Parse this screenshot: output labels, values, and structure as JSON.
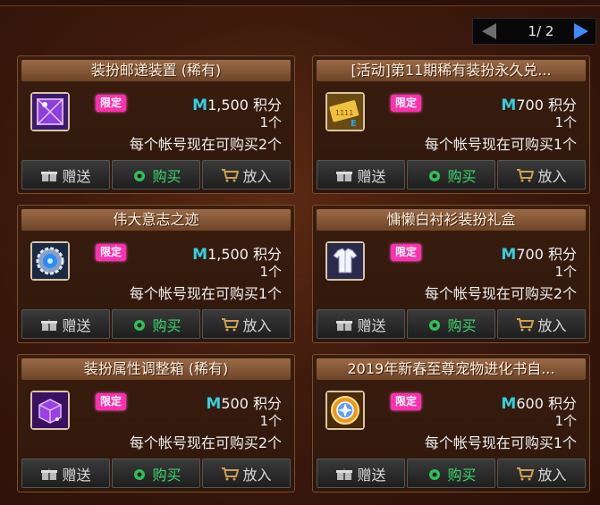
{
  "pager": {
    "text": "1/ 2"
  },
  "buttons": {
    "gift": "赠送",
    "buy": "购买",
    "cart": "放入"
  },
  "items": [
    {
      "title": "装扮邮递装置 (稀有)",
      "tag": "限定",
      "currency": "M",
      "price": "1,500",
      "unit": "积分",
      "qty": "1个",
      "limit": "每个帐号现在可购买2个",
      "icon": "purple-box-icon"
    },
    {
      "title": "[活动]第11期稀有装扮永久兑...",
      "tag": "限定",
      "currency": "M",
      "price": "700",
      "unit": "积分",
      "qty": "1个",
      "limit": "每个帐号现在可购买1个",
      "icon": "coupon-ticket-icon"
    },
    {
      "title": "伟大意志之迹",
      "tag": "限定",
      "currency": "M",
      "price": "1,500",
      "unit": "积分",
      "qty": "1个",
      "limit": "每个帐号现在可购买1个",
      "icon": "blue-gear-icon"
    },
    {
      "title": "慵懒白衬衫装扮礼盒",
      "tag": "限定",
      "currency": "M",
      "price": "700",
      "unit": "积分",
      "qty": "1个",
      "limit": "每个帐号现在可购买2个",
      "icon": "white-shirt-icon"
    },
    {
      "title": "装扮属性调整箱 (稀有)",
      "tag": "限定",
      "currency": "M",
      "price": "500",
      "unit": "积分",
      "qty": "1个",
      "limit": "每个帐号现在可购买2个",
      "icon": "purple-cube-icon"
    },
    {
      "title": "2019年新春至尊宠物进化书自...",
      "tag": "限定",
      "currency": "M",
      "price": "600",
      "unit": "积分",
      "qty": "1个",
      "limit": "每个帐号现在可购买1个",
      "icon": "gold-orb-icon"
    }
  ]
}
